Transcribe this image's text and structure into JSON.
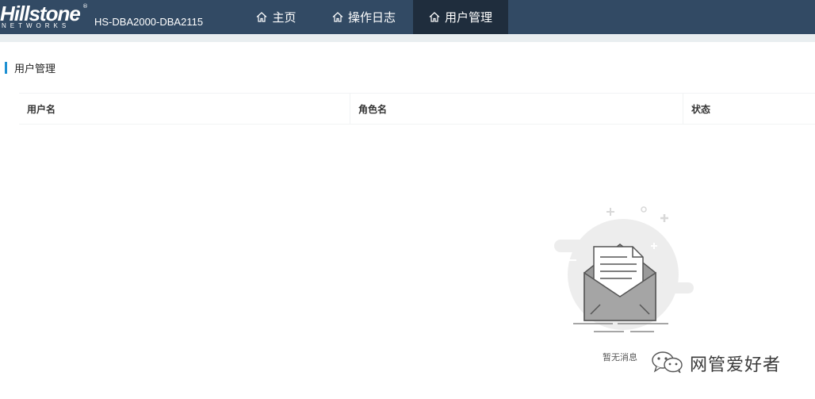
{
  "brand": {
    "name": "Hillstone",
    "sub": "NETWORKS",
    "reg": "®"
  },
  "device": {
    "name": "HS-DBA2000-DBA2115"
  },
  "nav": {
    "tabs": [
      {
        "label": "主页",
        "icon": "home-icon",
        "active": false
      },
      {
        "label": "操作日志",
        "icon": "home-icon",
        "active": false
      },
      {
        "label": "用户管理",
        "icon": "home-icon",
        "active": true
      }
    ]
  },
  "page": {
    "title": "用户管理",
    "accent_color": "#1e90d2"
  },
  "table": {
    "columns": [
      "用户名",
      "角色名",
      "状态"
    ],
    "rows": []
  },
  "empty_state": {
    "icon": "empty-inbox-illustration",
    "text": "暂无消息"
  },
  "watermark": {
    "icon": "wechat-icon",
    "text": "网管爱好者"
  }
}
